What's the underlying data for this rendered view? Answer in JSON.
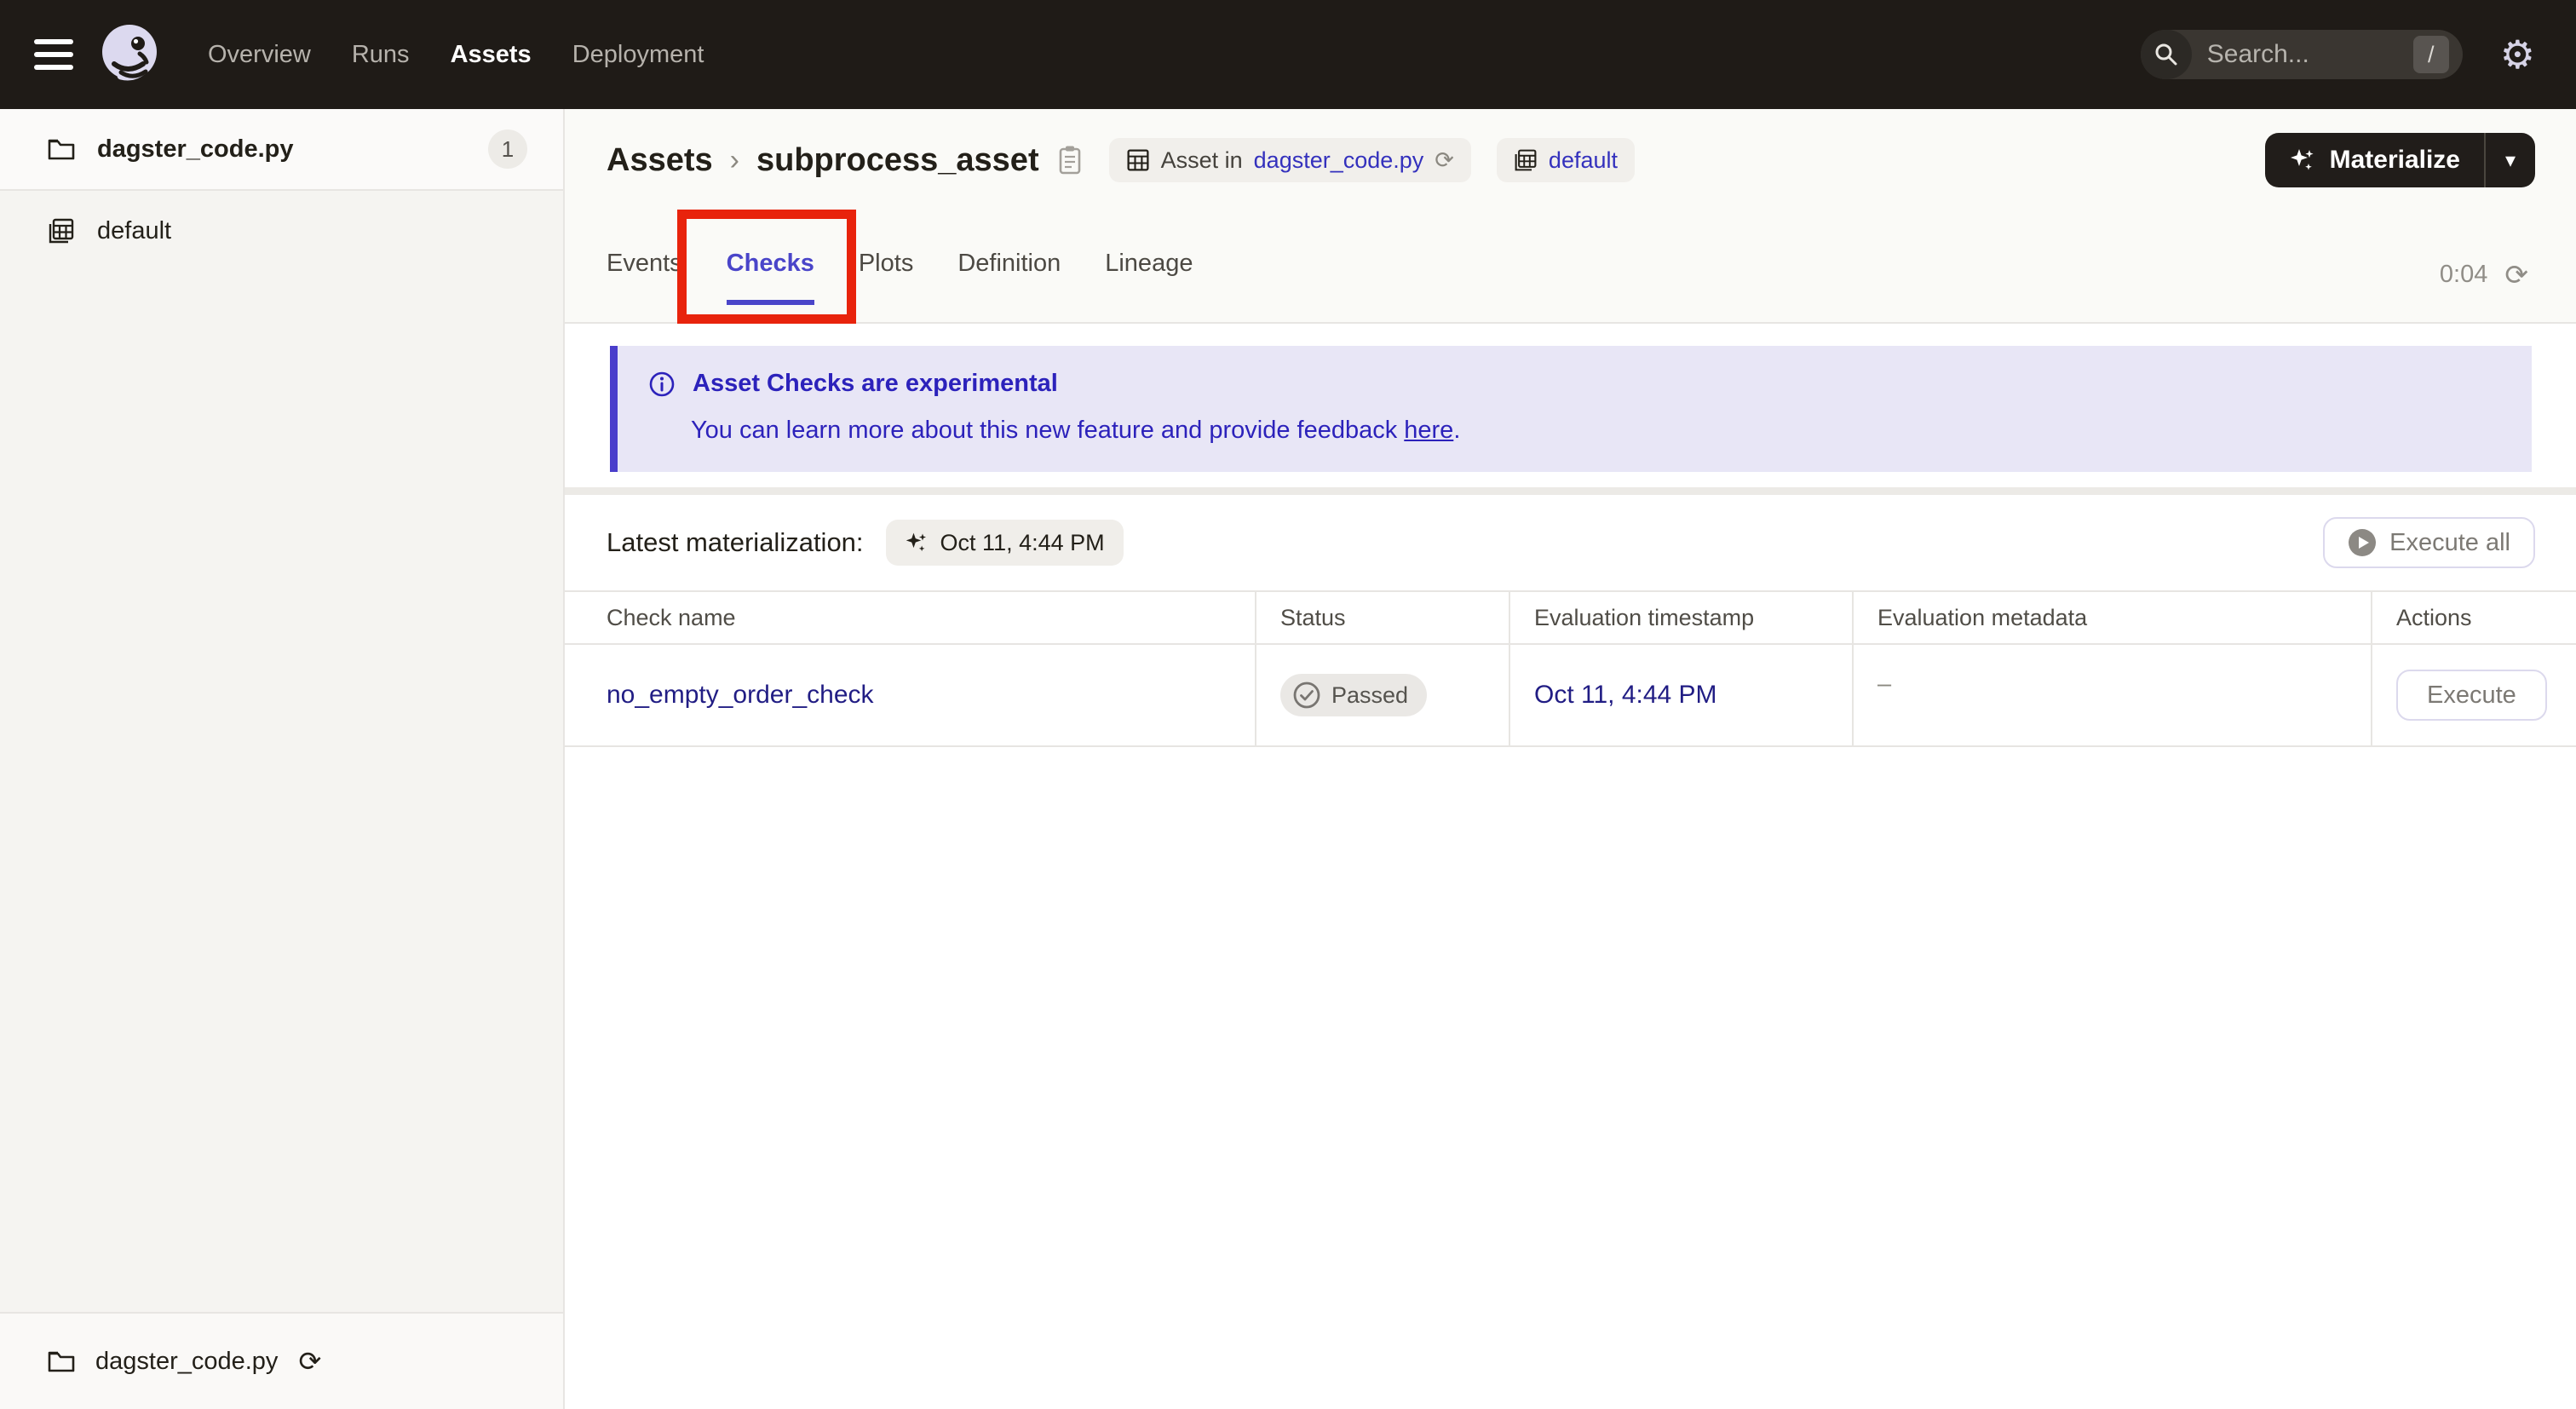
{
  "topnav": {
    "menu": [
      {
        "label": "Overview",
        "active": false
      },
      {
        "label": "Runs",
        "active": false
      },
      {
        "label": "Assets",
        "active": true
      },
      {
        "label": "Deployment",
        "active": false
      }
    ],
    "search": {
      "placeholder": "Search...",
      "shortcut": "/"
    }
  },
  "sidebar": {
    "items": [
      {
        "label": "dagster_code.py",
        "badge": "1",
        "icon": "folder-icon",
        "selected": true
      },
      {
        "label": "default",
        "icon": "asset-group-icon",
        "selected": false
      }
    ],
    "footer": {
      "label": "dagster_code.py",
      "refresh_icon": "refresh-icon",
      "refresh_glyph": "⟳"
    }
  },
  "header": {
    "breadcrumb": {
      "root": "Assets",
      "separator": "›",
      "current": "subprocess_asset"
    },
    "tags": [
      {
        "prefix": "Asset in",
        "link": "dagster_code.py",
        "refresh_glyph": "⟳"
      },
      {
        "link": "default"
      }
    ],
    "materialize": {
      "label": "Materialize",
      "caret": "▾"
    }
  },
  "tabs": {
    "items": [
      "Events",
      "Checks",
      "Plots",
      "Definition",
      "Lineage"
    ],
    "active": "Checks",
    "timer": "0:04",
    "refresh_glyph": "⟳"
  },
  "banner": {
    "title": "Asset Checks are experimental",
    "body": "You can learn more about this new feature and provide feedback ",
    "link_text": "here",
    "period": "."
  },
  "toolbar": {
    "latest_label": "Latest materialization:",
    "latest_value": "Oct 11, 4:44 PM",
    "execute_all_label": "Execute all"
  },
  "table": {
    "columns": [
      "Check name",
      "Status",
      "Evaluation timestamp",
      "Evaluation metadata",
      "Actions"
    ],
    "rows": [
      {
        "name": "no_empty_order_check",
        "status": "Passed",
        "timestamp": "Oct 11, 4:44 PM",
        "metadata": "–",
        "action_label": "Execute"
      }
    ]
  },
  "colors": {
    "topnav_bg": "#1f1b17",
    "accent_indigo": "#4a45c9",
    "banner_bg": "#e8e6f6",
    "banner_text": "#2c22bb",
    "banner_border": "#4a3ecb",
    "link_navy": "#211d84",
    "tag_link": "#3431bd",
    "annotation_red": "#e8230c",
    "sidebar_bg": "#f5f4f1",
    "header_zone_bg": "#fafaf7",
    "border_gray": "#e7e5e2"
  }
}
